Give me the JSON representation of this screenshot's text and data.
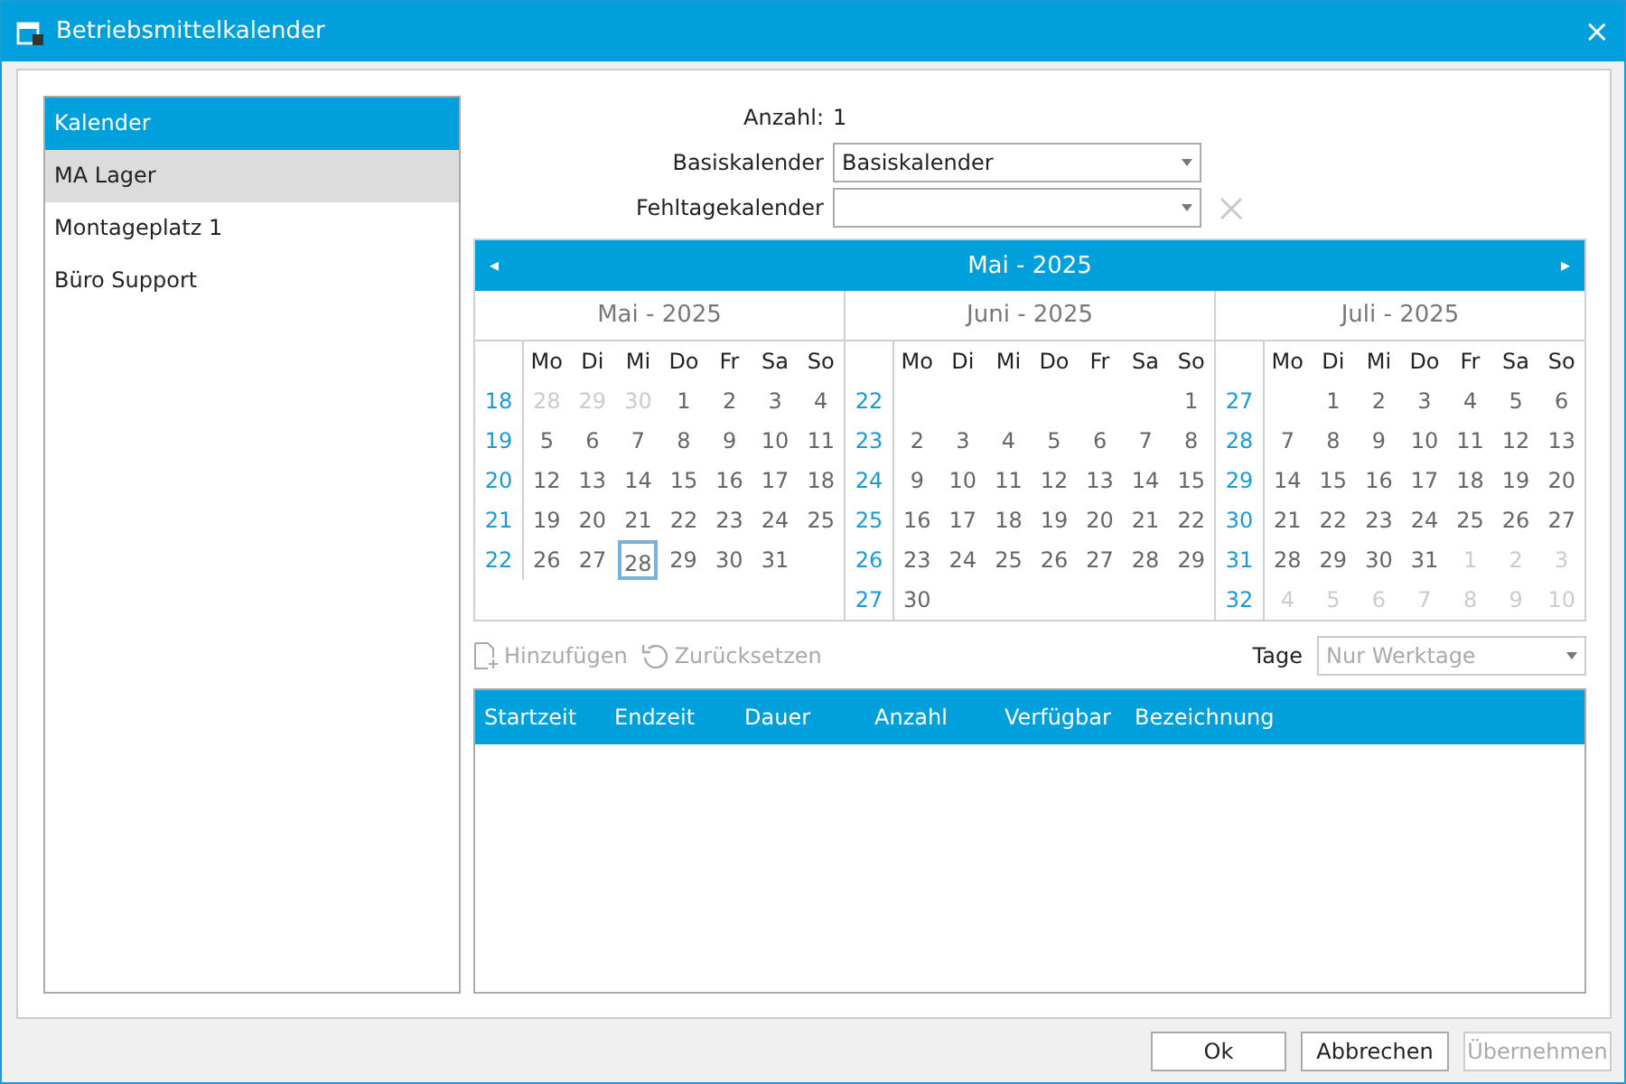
{
  "window": {
    "title": "Betriebsmittelkalender",
    "close": "×"
  },
  "sidebar": {
    "items": [
      {
        "label": "Kalender",
        "selected": true,
        "hovered": false
      },
      {
        "label": "MA Lager",
        "selected": false,
        "hovered": true
      },
      {
        "label": "Montageplatz 1",
        "selected": false,
        "hovered": false
      },
      {
        "label": "Büro Support",
        "selected": false,
        "hovered": false
      }
    ]
  },
  "form": {
    "count_label": "Anzahl:",
    "count_value": "1",
    "base_label": "Basiskalender",
    "base_value": "Basiskalender",
    "absence_label": "Fehltagekalender"
  },
  "calendar": {
    "title": "Mai - 2025",
    "prev": "◂",
    "next": "▸",
    "months": [
      {
        "title": "Mai - 2025",
        "weekdays": [
          "Mo",
          "Di",
          "Mi",
          "Do",
          "Fr",
          "Sa",
          "So"
        ],
        "weeks": [
          {
            "week": "18",
            "days": [
              {
                "kind": "day",
                "day": "28",
                "muted": true,
                "today": false
              },
              {
                "kind": "day",
                "day": "29",
                "muted": true,
                "today": false
              },
              {
                "kind": "day",
                "day": "30",
                "muted": true,
                "today": false
              },
              {
                "kind": "day",
                "day": "1",
                "muted": false,
                "today": false
              },
              {
                "kind": "day",
                "day": "2",
                "muted": false,
                "today": false
              },
              {
                "kind": "day",
                "day": "3",
                "muted": false,
                "today": false
              },
              {
                "kind": "day",
                "day": "4",
                "muted": false,
                "today": false
              }
            ]
          },
          {
            "week": "19",
            "days": [
              {
                "kind": "day",
                "day": "5",
                "muted": false,
                "today": false
              },
              {
                "kind": "day",
                "day": "6",
                "muted": false,
                "today": false
              },
              {
                "kind": "day",
                "day": "7",
                "muted": false,
                "today": false
              },
              {
                "kind": "day",
                "day": "8",
                "muted": false,
                "today": false
              },
              {
                "kind": "day",
                "day": "9",
                "muted": false,
                "today": false
              },
              {
                "kind": "day",
                "day": "10",
                "muted": false,
                "today": false
              },
              {
                "kind": "day",
                "day": "11",
                "muted": false,
                "today": false
              }
            ]
          },
          {
            "week": "20",
            "days": [
              {
                "kind": "day",
                "day": "12",
                "muted": false,
                "today": false
              },
              {
                "kind": "day",
                "day": "13",
                "muted": false,
                "today": false
              },
              {
                "kind": "day",
                "day": "14",
                "muted": false,
                "today": false
              },
              {
                "kind": "day",
                "day": "15",
                "muted": false,
                "today": false
              },
              {
                "kind": "day",
                "day": "16",
                "muted": false,
                "today": false
              },
              {
                "kind": "day",
                "day": "17",
                "muted": false,
                "today": false
              },
              {
                "kind": "day",
                "day": "18",
                "muted": false,
                "today": false
              }
            ]
          },
          {
            "week": "21",
            "days": [
              {
                "kind": "day",
                "day": "19",
                "muted": false,
                "today": false
              },
              {
                "kind": "day",
                "day": "20",
                "muted": false,
                "today": false
              },
              {
                "kind": "day",
                "day": "21",
                "muted": false,
                "today": false
              },
              {
                "kind": "day",
                "day": "22",
                "muted": false,
                "today": false
              },
              {
                "kind": "day",
                "day": "23",
                "muted": false,
                "today": false
              },
              {
                "kind": "day",
                "day": "24",
                "muted": false,
                "today": false
              },
              {
                "kind": "day",
                "day": "25",
                "muted": false,
                "today": false
              }
            ]
          },
          {
            "week": "22",
            "days": [
              {
                "kind": "day",
                "day": "26",
                "muted": false,
                "today": false
              },
              {
                "kind": "day",
                "day": "27",
                "muted": false,
                "today": false
              },
              {
                "kind": "day",
                "day": "28",
                "muted": false,
                "today": true
              },
              {
                "kind": "day",
                "day": "29",
                "muted": false,
                "today": false
              },
              {
                "kind": "day",
                "day": "30",
                "muted": false,
                "today": false
              },
              {
                "kind": "day",
                "day": "31",
                "muted": false,
                "today": false
              },
              {
                "kind": "blank"
              }
            ]
          }
        ]
      },
      {
        "title": "Juni - 2025",
        "weekdays": [
          "Mo",
          "Di",
          "Mi",
          "Do",
          "Fr",
          "Sa",
          "So"
        ],
        "weeks": [
          {
            "week": "22",
            "days": [
              {
                "kind": "blank"
              },
              {
                "kind": "blank"
              },
              {
                "kind": "blank"
              },
              {
                "kind": "blank"
              },
              {
                "kind": "blank"
              },
              {
                "kind": "blank"
              },
              {
                "kind": "day",
                "day": "1",
                "muted": false,
                "today": false
              }
            ]
          },
          {
            "week": "23",
            "days": [
              {
                "kind": "day",
                "day": "2",
                "muted": false,
                "today": false
              },
              {
                "kind": "day",
                "day": "3",
                "muted": false,
                "today": false
              },
              {
                "kind": "day",
                "day": "4",
                "muted": false,
                "today": false
              },
              {
                "kind": "day",
                "day": "5",
                "muted": false,
                "today": false
              },
              {
                "kind": "day",
                "day": "6",
                "muted": false,
                "today": false
              },
              {
                "kind": "day",
                "day": "7",
                "muted": false,
                "today": false
              },
              {
                "kind": "day",
                "day": "8",
                "muted": false,
                "today": false
              }
            ]
          },
          {
            "week": "24",
            "days": [
              {
                "kind": "day",
                "day": "9",
                "muted": false,
                "today": false
              },
              {
                "kind": "day",
                "day": "10",
                "muted": false,
                "today": false
              },
              {
                "kind": "day",
                "day": "11",
                "muted": false,
                "today": false
              },
              {
                "kind": "day",
                "day": "12",
                "muted": false,
                "today": false
              },
              {
                "kind": "day",
                "day": "13",
                "muted": false,
                "today": false
              },
              {
                "kind": "day",
                "day": "14",
                "muted": false,
                "today": false
              },
              {
                "kind": "day",
                "day": "15",
                "muted": false,
                "today": false
              }
            ]
          },
          {
            "week": "25",
            "days": [
              {
                "kind": "day",
                "day": "16",
                "muted": false,
                "today": false
              },
              {
                "kind": "day",
                "day": "17",
                "muted": false,
                "today": false
              },
              {
                "kind": "day",
                "day": "18",
                "muted": false,
                "today": false
              },
              {
                "kind": "day",
                "day": "19",
                "muted": false,
                "today": false
              },
              {
                "kind": "day",
                "day": "20",
                "muted": false,
                "today": false
              },
              {
                "kind": "day",
                "day": "21",
                "muted": false,
                "today": false
              },
              {
                "kind": "day",
                "day": "22",
                "muted": false,
                "today": false
              }
            ]
          },
          {
            "week": "26",
            "days": [
              {
                "kind": "day",
                "day": "23",
                "muted": false,
                "today": false
              },
              {
                "kind": "day",
                "day": "24",
                "muted": false,
                "today": false
              },
              {
                "kind": "day",
                "day": "25",
                "muted": false,
                "today": false
              },
              {
                "kind": "day",
                "day": "26",
                "muted": false,
                "today": false
              },
              {
                "kind": "day",
                "day": "27",
                "muted": false,
                "today": false
              },
              {
                "kind": "day",
                "day": "28",
                "muted": false,
                "today": false
              },
              {
                "kind": "day",
                "day": "29",
                "muted": false,
                "today": false
              }
            ]
          },
          {
            "week": "27",
            "days": [
              {
                "kind": "day",
                "day": "30",
                "muted": false,
                "today": false
              },
              {
                "kind": "blank"
              },
              {
                "kind": "blank"
              },
              {
                "kind": "blank"
              },
              {
                "kind": "blank"
              },
              {
                "kind": "blank"
              },
              {
                "kind": "blank"
              }
            ]
          }
        ]
      },
      {
        "title": "Juli - 2025",
        "weekdays": [
          "Mo",
          "Di",
          "Mi",
          "Do",
          "Fr",
          "Sa",
          "So"
        ],
        "weeks": [
          {
            "week": "27",
            "days": [
              {
                "kind": "blank"
              },
              {
                "kind": "day",
                "day": "1",
                "muted": false,
                "today": false
              },
              {
                "kind": "day",
                "day": "2",
                "muted": false,
                "today": false
              },
              {
                "kind": "day",
                "day": "3",
                "muted": false,
                "today": false
              },
              {
                "kind": "day",
                "day": "4",
                "muted": false,
                "today": false
              },
              {
                "kind": "day",
                "day": "5",
                "muted": false,
                "today": false
              },
              {
                "kind": "day",
                "day": "6",
                "muted": false,
                "today": false
              }
            ]
          },
          {
            "week": "28",
            "days": [
              {
                "kind": "day",
                "day": "7",
                "muted": false,
                "today": false
              },
              {
                "kind": "day",
                "day": "8",
                "muted": false,
                "today": false
              },
              {
                "kind": "day",
                "day": "9",
                "muted": false,
                "today": false
              },
              {
                "kind": "day",
                "day": "10",
                "muted": false,
                "today": false
              },
              {
                "kind": "day",
                "day": "11",
                "muted": false,
                "today": false
              },
              {
                "kind": "day",
                "day": "12",
                "muted": false,
                "today": false
              },
              {
                "kind": "day",
                "day": "13",
                "muted": false,
                "today": false
              }
            ]
          },
          {
            "week": "29",
            "days": [
              {
                "kind": "day",
                "day": "14",
                "muted": false,
                "today": false
              },
              {
                "kind": "day",
                "day": "15",
                "muted": false,
                "today": false
              },
              {
                "kind": "day",
                "day": "16",
                "muted": false,
                "today": false
              },
              {
                "kind": "day",
                "day": "17",
                "muted": false,
                "today": false
              },
              {
                "kind": "day",
                "day": "18",
                "muted": false,
                "today": false
              },
              {
                "kind": "day",
                "day": "19",
                "muted": false,
                "today": false
              },
              {
                "kind": "day",
                "day": "20",
                "muted": false,
                "today": false
              }
            ]
          },
          {
            "week": "30",
            "days": [
              {
                "kind": "day",
                "day": "21",
                "muted": false,
                "today": false
              },
              {
                "kind": "day",
                "day": "22",
                "muted": false,
                "today": false
              },
              {
                "kind": "day",
                "day": "23",
                "muted": false,
                "today": false
              },
              {
                "kind": "day",
                "day": "24",
                "muted": false,
                "today": false
              },
              {
                "kind": "day",
                "day": "25",
                "muted": false,
                "today": false
              },
              {
                "kind": "day",
                "day": "26",
                "muted": false,
                "today": false
              },
              {
                "kind": "day",
                "day": "27",
                "muted": false,
                "today": false
              }
            ]
          },
          {
            "week": "31",
            "days": [
              {
                "kind": "day",
                "day": "28",
                "muted": false,
                "today": false
              },
              {
                "kind": "day",
                "day": "29",
                "muted": false,
                "today": false
              },
              {
                "kind": "day",
                "day": "30",
                "muted": false,
                "today": false
              },
              {
                "kind": "day",
                "day": "31",
                "muted": false,
                "today": false
              },
              {
                "kind": "day",
                "day": "1",
                "muted": true,
                "today": false
              },
              {
                "kind": "day",
                "day": "2",
                "muted": true,
                "today": false
              },
              {
                "kind": "day",
                "day": "3",
                "muted": true,
                "today": false
              }
            ]
          },
          {
            "week": "32",
            "days": [
              {
                "kind": "day",
                "day": "4",
                "muted": true,
                "today": false
              },
              {
                "kind": "day",
                "day": "5",
                "muted": true,
                "today": false
              },
              {
                "kind": "day",
                "day": "6",
                "muted": true,
                "today": false
              },
              {
                "kind": "day",
                "day": "7",
                "muted": true,
                "today": false
              },
              {
                "kind": "day",
                "day": "8",
                "muted": true,
                "today": false
              },
              {
                "kind": "day",
                "day": "9",
                "muted": true,
                "today": false
              },
              {
                "kind": "day",
                "day": "10",
                "muted": true,
                "today": false
              }
            ]
          }
        ]
      }
    ]
  },
  "toolbar": {
    "add": {
      "label": "Hinzufügen",
      "disabled": true
    },
    "reset": {
      "label": "Zurücksetzen",
      "disabled": true
    },
    "days_label": "Tage",
    "days_value": "Nur Werktage",
    "days_disabled": true
  },
  "table": {
    "columns": [
      "Startzeit",
      "Endzeit",
      "Dauer",
      "Anzahl",
      "Verfügbar",
      "Bezeichnung"
    ]
  },
  "buttons": [
    {
      "label": "Ok",
      "disabled": false
    },
    {
      "label": "Abbrechen",
      "disabled": false
    },
    {
      "label": "Übernehmen",
      "disabled": true
    }
  ]
}
